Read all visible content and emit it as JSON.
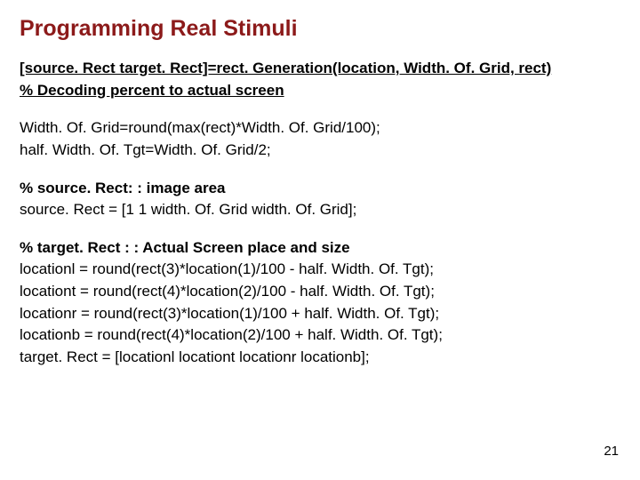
{
  "title": "Programming Real Stimuli",
  "lines": {
    "sig": "[source. Rect  target. Rect]=rect. Generation(location, Width. Of. Grid, rect)",
    "decode": "% Decoding percent to actual screen",
    "wog": "Width. Of. Grid=round(max(rect)*Width. Of. Grid/100);",
    "half": "half. Width. Of. Tgt=Width. Of. Grid/2;",
    "srcHead": "% source. Rect:  :  image area",
    "srcAssign": "source. Rect = [1 1 width. Of. Grid width. Of. Grid];",
    "tgtHead": "% target. Rect  : : Actual Screen place and size",
    "locl": "locationl = round(rect(3)*location(1)/100 - half. Width. Of. Tgt);",
    "loct": "locationt = round(rect(4)*location(2)/100 - half. Width. Of. Tgt);",
    "locr": "locationr = round(rect(3)*location(1)/100 + half. Width. Of. Tgt);",
    "locb": "locationb = round(rect(4)*location(2)/100 + half. Width. Of. Tgt);",
    "tgtAssign": "target. Rect = [locationl locationt locationr locationb];"
  },
  "pageNumber": "21"
}
